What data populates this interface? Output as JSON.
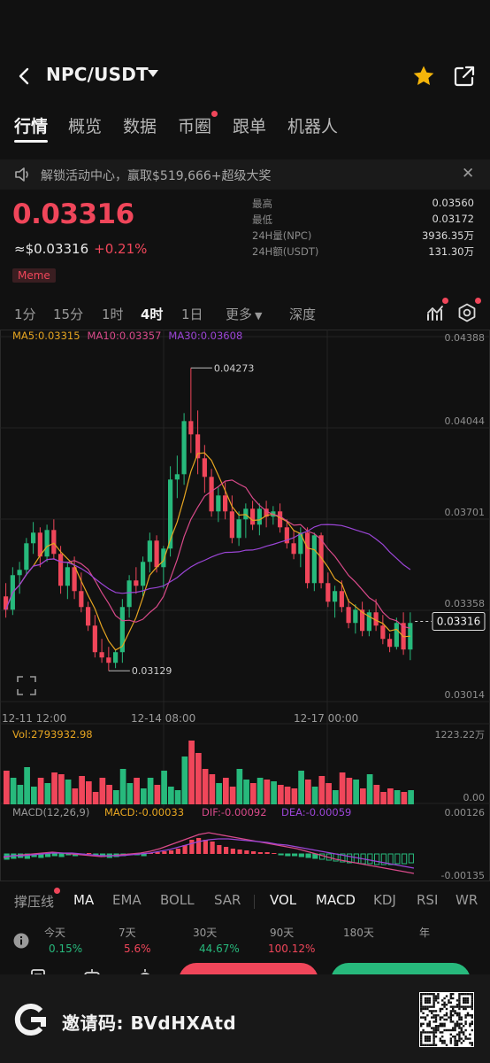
{
  "header": {
    "pair": "NPC/USDT"
  },
  "tabs": [
    "行情",
    "概览",
    "数据",
    "币圈",
    "跟单",
    "机器人"
  ],
  "notice": {
    "text": "解锁活动中心，赢取$519,666+超级大奖"
  },
  "price": {
    "last": "0.03316",
    "usd": "≈$0.03316",
    "change": "+0.21%",
    "tag": "Meme"
  },
  "stats": [
    {
      "label": "最高",
      "value": "0.03560"
    },
    {
      "label": "最低",
      "value": "0.03172"
    },
    {
      "label": "24H量(NPC)",
      "value": "3936.35万"
    },
    {
      "label": "24H额(USDT)",
      "value": "131.30万"
    }
  ],
  "intervals": [
    "1分",
    "15分",
    "1时",
    "4时",
    "1日",
    "更多",
    "深度"
  ],
  "ma_legend": {
    "ma5": "MA5:0.03315",
    "ma10": "MA10:0.03357",
    "ma30": "MA30:0.03608"
  },
  "colors": {
    "up": "#27b97c",
    "down": "#f0465a",
    "ma5": "#e6a521",
    "ma10": "#d84a8a",
    "ma30": "#9b45d6",
    "accent": "#f5b50a"
  },
  "chart_data": {
    "type": "candlestick",
    "y_ticks": [
      "0.04388",
      "0.04044",
      "0.03701",
      "0.03358",
      "0.03014"
    ],
    "ylim": [
      0.03014,
      0.04388
    ],
    "x_ticks": [
      "12-11 12:00",
      "12-14 08:00",
      "12-17 00:00"
    ],
    "high_label": "0.04273",
    "low_label": "0.03129",
    "current_label": "0.03316",
    "candles_ohlc": [
      [
        0.0341,
        0.0346,
        0.0333,
        0.0336
      ],
      [
        0.0336,
        0.0352,
        0.0334,
        0.0349
      ],
      [
        0.0349,
        0.0354,
        0.0342,
        0.0351
      ],
      [
        0.0351,
        0.0363,
        0.0349,
        0.0361
      ],
      [
        0.0361,
        0.0369,
        0.0357,
        0.0365
      ],
      [
        0.0365,
        0.0367,
        0.0352,
        0.0356
      ],
      [
        0.0356,
        0.0368,
        0.0354,
        0.0366
      ],
      [
        0.0366,
        0.037,
        0.0355,
        0.0357
      ],
      [
        0.0357,
        0.036,
        0.0342,
        0.0345
      ],
      [
        0.0345,
        0.0354,
        0.034,
        0.0352
      ],
      [
        0.0352,
        0.0356,
        0.034,
        0.0343
      ],
      [
        0.0343,
        0.035,
        0.0335,
        0.0337
      ],
      [
        0.0337,
        0.0339,
        0.0328,
        0.033
      ],
      [
        0.033,
        0.0334,
        0.0318,
        0.032
      ],
      [
        0.032,
        0.0325,
        0.0316,
        0.0318
      ],
      [
        0.0318,
        0.0322,
        0.0313,
        0.0316
      ],
      [
        0.0316,
        0.0321,
        0.0314,
        0.032
      ],
      [
        0.032,
        0.034,
        0.0316,
        0.0337
      ],
      [
        0.0337,
        0.0349,
        0.0333,
        0.0347
      ],
      [
        0.0347,
        0.0352,
        0.0342,
        0.0345
      ],
      [
        0.0345,
        0.0356,
        0.0341,
        0.0354
      ],
      [
        0.0354,
        0.0365,
        0.035,
        0.0362
      ],
      [
        0.0362,
        0.0364,
        0.035,
        0.0352
      ],
      [
        0.0352,
        0.036,
        0.0344,
        0.0359
      ],
      [
        0.0359,
        0.039,
        0.0356,
        0.0385
      ],
      [
        0.0385,
        0.0394,
        0.0378,
        0.0387
      ],
      [
        0.0387,
        0.041,
        0.0383,
        0.0407
      ],
      [
        0.0407,
        0.0427,
        0.0395,
        0.0402
      ],
      [
        0.0402,
        0.0411,
        0.0387,
        0.0393
      ],
      [
        0.0393,
        0.0398,
        0.038,
        0.0386
      ],
      [
        0.0386,
        0.0389,
        0.0371,
        0.0373
      ],
      [
        0.0373,
        0.0382,
        0.0369,
        0.0379
      ],
      [
        0.0379,
        0.0384,
        0.037,
        0.0373
      ],
      [
        0.0373,
        0.0379,
        0.0361,
        0.0363
      ],
      [
        0.0363,
        0.0373,
        0.036,
        0.037
      ],
      [
        0.037,
        0.0376,
        0.0363,
        0.0374
      ],
      [
        0.0374,
        0.0377,
        0.0366,
        0.0368
      ],
      [
        0.0368,
        0.0376,
        0.0364,
        0.0374
      ],
      [
        0.0374,
        0.0377,
        0.0367,
        0.0371
      ],
      [
        0.0371,
        0.0375,
        0.0368,
        0.0373
      ],
      [
        0.0373,
        0.0376,
        0.0365,
        0.0367
      ],
      [
        0.0367,
        0.037,
        0.0359,
        0.0361
      ],
      [
        0.0361,
        0.0366,
        0.0355,
        0.0357
      ],
      [
        0.0357,
        0.0367,
        0.0352,
        0.0365
      ],
      [
        0.0365,
        0.0367,
        0.0344,
        0.0346
      ],
      [
        0.0346,
        0.0365,
        0.0343,
        0.0364
      ],
      [
        0.0364,
        0.0365,
        0.0344,
        0.0346
      ],
      [
        0.0346,
        0.035,
        0.0337,
        0.0339
      ],
      [
        0.0339,
        0.0345,
        0.0333,
        0.0343
      ],
      [
        0.0343,
        0.0347,
        0.0335,
        0.0337
      ],
      [
        0.0337,
        0.034,
        0.0329,
        0.0331
      ],
      [
        0.0331,
        0.0338,
        0.0327,
        0.0336
      ],
      [
        0.0336,
        0.0339,
        0.0326,
        0.0328
      ],
      [
        0.0328,
        0.0336,
        0.0326,
        0.0335
      ],
      [
        0.0335,
        0.034,
        0.0328,
        0.033
      ],
      [
        0.033,
        0.0334,
        0.0323,
        0.0325
      ],
      [
        0.0325,
        0.0327,
        0.032,
        0.0322
      ],
      [
        0.0322,
        0.0333,
        0.0321,
        0.0331
      ],
      [
        0.0331,
        0.0335,
        0.0319,
        0.0321
      ],
      [
        0.0321,
        0.0335,
        0.0317,
        0.0331
      ]
    ],
    "vol_label": "Vol:2793932.98",
    "vol_max_label": "1223.22万",
    "vol_min_label": "0.00",
    "macd_label": "MACD(12,26,9)",
    "macd_value": "MACD:-0.00033",
    "dif_value": "DIF:-0.00092",
    "dea_value": "DEA:-0.00059",
    "macd_top": "0.00126",
    "macd_bottom": "-0.00135"
  },
  "indicators": [
    "撑压线",
    "MA",
    "EMA",
    "BOLL",
    "SAR",
    "VOL",
    "MACD",
    "KDJ",
    "RSI",
    "WR"
  ],
  "performance": [
    {
      "label": "今天",
      "value": "0.15%"
    },
    {
      "label": "7天",
      "value": "5.6%"
    },
    {
      "label": "30天",
      "value": "44.67%"
    },
    {
      "label": "90天",
      "value": "100.12%"
    },
    {
      "label": "180天",
      "value": ""
    },
    {
      "label": "年",
      "value": ""
    }
  ],
  "banner": {
    "invite": "邀请码: BVdHXAtd"
  }
}
